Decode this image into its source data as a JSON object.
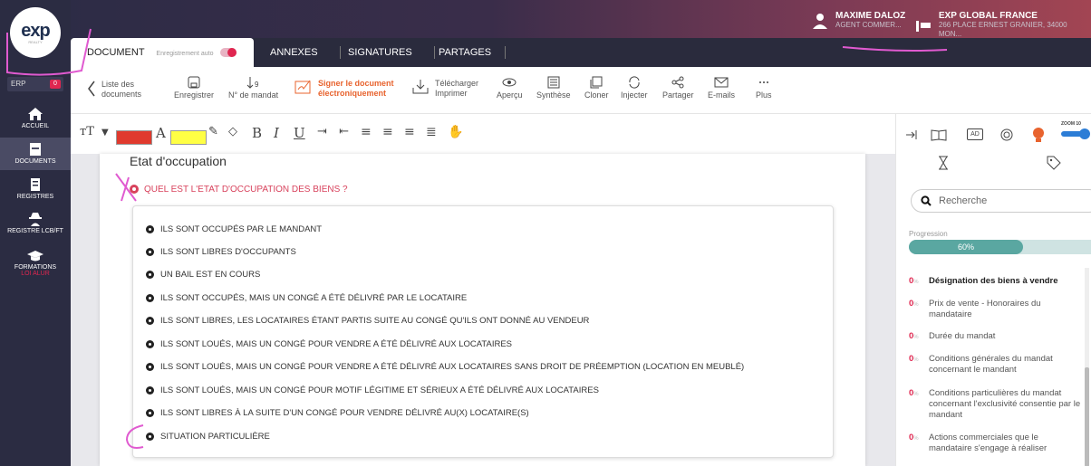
{
  "header": {
    "user": {
      "name": "MAXIME DALOZ",
      "role": "AGENT COMMER..."
    },
    "agency": {
      "name": "EXP GLOBAL FRANCE",
      "address": "266 PLACE ERNEST GRANIER, 34000 MON..."
    }
  },
  "sidebar": {
    "logo": {
      "brand": "exp",
      "sub": "REALTY"
    },
    "erp": {
      "label": "ERP",
      "count": "0"
    },
    "items": [
      {
        "label": "ACCUEIL",
        "icon": "home-icon"
      },
      {
        "label": "DOCUMENTS",
        "icon": "documents-icon"
      },
      {
        "label": "REGISTRES",
        "icon": "registres-icon"
      },
      {
        "label": "REGISTRE LCB/FT",
        "icon": "detective-icon"
      },
      {
        "label": "FORMATIONS",
        "sublabel": "LOI ALUR",
        "icon": "graduation-cap-icon"
      }
    ]
  },
  "tabs": {
    "document": "DOCUMENT",
    "autosave": "Enregistrement auto",
    "annexes": "ANNEXES",
    "signatures": "SIGNATURES",
    "partages": "PARTAGES"
  },
  "toolbar": {
    "back_line1": "Liste des",
    "back_line2": "documents",
    "save": "Enregistrer",
    "mandate_number": "N° de mandat",
    "sign_line1": "Signer le document",
    "sign_line2": "électroniquement",
    "download_line1": "Télécharger",
    "download_line2": "Imprimer",
    "preview": "Aperçu",
    "summary": "Synthèse",
    "clone": "Cloner",
    "inject": "Injecter",
    "share": "Partager",
    "emails": "E-mails",
    "more": "Plus"
  },
  "format": {
    "text_color": "#e03a2e",
    "highlight_color": "#ffff44"
  },
  "document": {
    "section_title": "Etat d'occupation",
    "question": "QUEL EST L'ETAT D'OCCUPATION DES BIENS ?",
    "options": [
      "ILS SONT OCCUPÉS PAR LE MANDANT",
      "ILS SONT LIBRES D'OCCUPANTS",
      "UN BAIL EST EN COURS",
      "ILS SONT OCCUPÉS, MAIS UN CONGÉ A ÉTÉ DÉLIVRÉ PAR LE LOCATAIRE",
      "ILS SONT LIBRES, LES LOCATAIRES ÉTANT PARTIS SUITE AU CONGÉ QU'ILS ONT DONNÉ AU VENDEUR",
      "ILS SONT LOUÉS, MAIS UN CONGÉ POUR VENDRE A ÉTÉ DÉLIVRÉ AUX LOCATAIRES",
      "ILS SONT LOUÉS, MAIS UN CONGÉ POUR VENDRE A ÉTÉ DÉLIVRÉ AUX LOCATAIRES SANS DROIT DE PRÉEMPTION (LOCATION EN MEUBLÉ)",
      "ILS SONT LOUÉS, MAIS UN CONGÉ POUR MOTIF LÉGITIME ET SÉRIEUX A ÉTÉ DÉLIVRÉ AUX LOCATAIRES",
      "ILS SONT LIBRES À LA SUITE D'UN CONGÉ POUR VENDRE DÉLIVRÉ AU(X) LOCATAIRE(S)",
      "SITUATION PARTICULIÈRE"
    ]
  },
  "right_panel": {
    "zoom_label": "ZOOM 10",
    "ad_label": "AD",
    "search_placeholder": "Recherche",
    "progress_label": "Progression",
    "progress_value": "60%",
    "progress_fraction": 0.6,
    "pct_symbol": "%",
    "sections": [
      {
        "pct": "0",
        "label": "Désignation des biens à vendre",
        "active": true
      },
      {
        "pct": "0",
        "label": "Prix de vente - Honoraires du mandataire"
      },
      {
        "pct": "0",
        "label": "Durée du mandat"
      },
      {
        "pct": "0",
        "label": "Conditions générales du mandat concernant le mandant"
      },
      {
        "pct": "0",
        "label": "Conditions particulières du mandat concernant l'exclusivité consentie par le mandant"
      },
      {
        "pct": "0",
        "label": "Actions commerciales que le mandataire s'engage à réaliser"
      }
    ]
  },
  "colors": {
    "accent": "#e02650",
    "orange": "#e8632e",
    "progress": "#5aa7a1",
    "annotation": "#e05ad0"
  }
}
